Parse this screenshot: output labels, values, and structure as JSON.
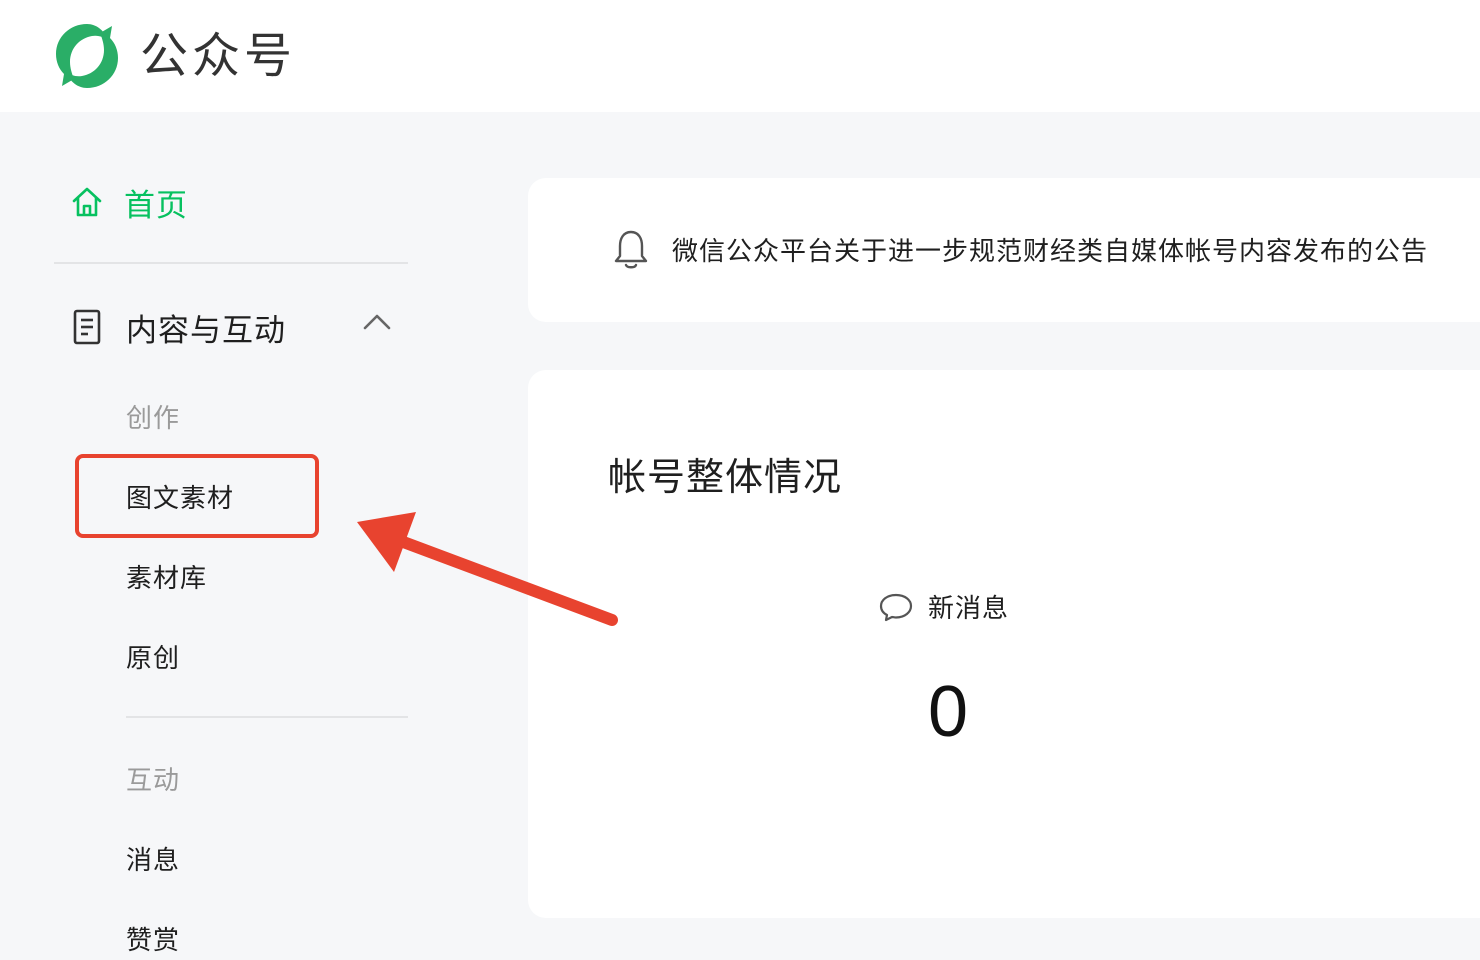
{
  "app": {
    "brand": "公众号"
  },
  "sidebar": {
    "home_label": "首页",
    "section_label": "内容与互动",
    "groups": [
      {
        "title": "创作",
        "items": [
          "图文素材",
          "素材库",
          "原创"
        ]
      },
      {
        "title": "互动",
        "items": [
          "消息",
          "赞赏"
        ]
      }
    ]
  },
  "notice": {
    "text": "微信公众平台关于进一步规范财经类自媒体帐号内容发布的公告"
  },
  "overview": {
    "title": "帐号整体情况",
    "metric_label": "新消息",
    "metric_value": "0"
  },
  "colors": {
    "brand_green": "#07c160",
    "annotation_red": "#e8432f"
  }
}
